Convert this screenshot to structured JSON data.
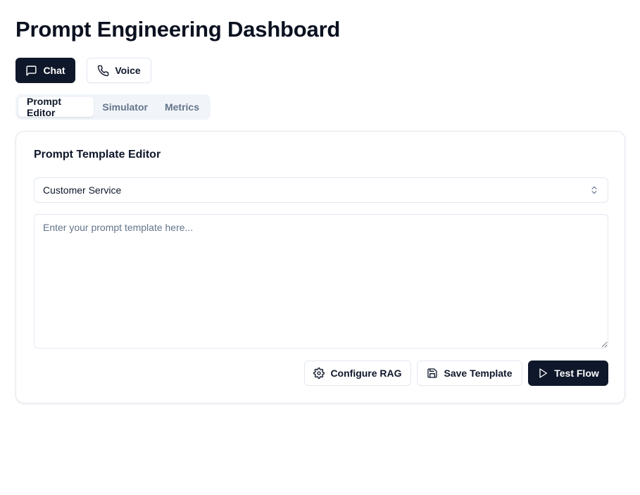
{
  "page": {
    "title": "Prompt Engineering Dashboard"
  },
  "modes": {
    "chat": {
      "label": "Chat",
      "icon": "message-square-icon"
    },
    "voice": {
      "label": "Voice",
      "icon": "phone-icon"
    }
  },
  "tabs": [
    {
      "label": "Prompt Editor",
      "active": true
    },
    {
      "label": "Simulator",
      "active": false
    },
    {
      "label": "Metrics",
      "active": false
    }
  ],
  "editor": {
    "title": "Prompt Template Editor",
    "template_select": {
      "value": "Customer Service"
    },
    "prompt_textarea": {
      "value": "",
      "placeholder": "Enter your prompt template here..."
    }
  },
  "actions": {
    "configure_rag": {
      "label": "Configure RAG",
      "icon": "settings-icon"
    },
    "save_template": {
      "label": "Save Template",
      "icon": "save-icon"
    },
    "test_flow": {
      "label": "Test Flow",
      "icon": "play-icon"
    }
  },
  "colors": {
    "primary": "#0f172a",
    "border": "#e2e8f0",
    "muted_text": "#64748b",
    "tab_track": "#f1f5f9"
  }
}
